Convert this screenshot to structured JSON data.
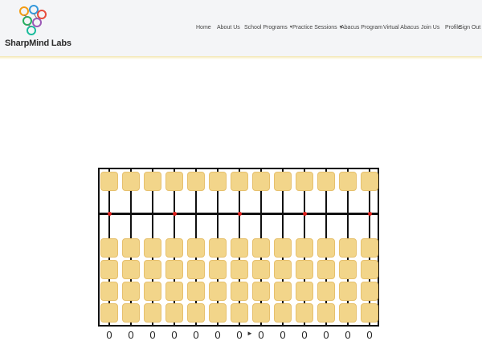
{
  "brand": {
    "name": "SharpMind Labs",
    "colors": [
      "#f39c12",
      "#3498db",
      "#27ae60",
      "#e74c3c",
      "#9b59b6",
      "#1abc9c"
    ]
  },
  "nav": {
    "items": [
      {
        "label": "Home",
        "dropdown": false
      },
      {
        "label": "About Us",
        "dropdown": false
      },
      {
        "label": "School Programs",
        "dropdown": true
      },
      {
        "label": "Practice Sessions",
        "dropdown": true
      },
      {
        "label": "Abacus Program",
        "dropdown": false
      },
      {
        "label": "Virtual Abacus",
        "dropdown": false
      },
      {
        "label": "Join Us",
        "dropdown": false
      },
      {
        "label": "Profile",
        "dropdown": false
      },
      {
        "label": "Sign Out",
        "dropdown": false
      }
    ]
  },
  "abacus": {
    "rods": 13,
    "upper_beads_per_rod": 1,
    "lower_beads_per_rod": 4,
    "marker_color": "#e0201c",
    "bead_color": "#f2d58a",
    "marker_rods": [
      1,
      4,
      7,
      10,
      13
    ],
    "values": [
      "0",
      "0",
      "0",
      "0",
      "0",
      "0",
      "0",
      "0",
      "0",
      "0",
      "0",
      "0",
      "0"
    ]
  }
}
